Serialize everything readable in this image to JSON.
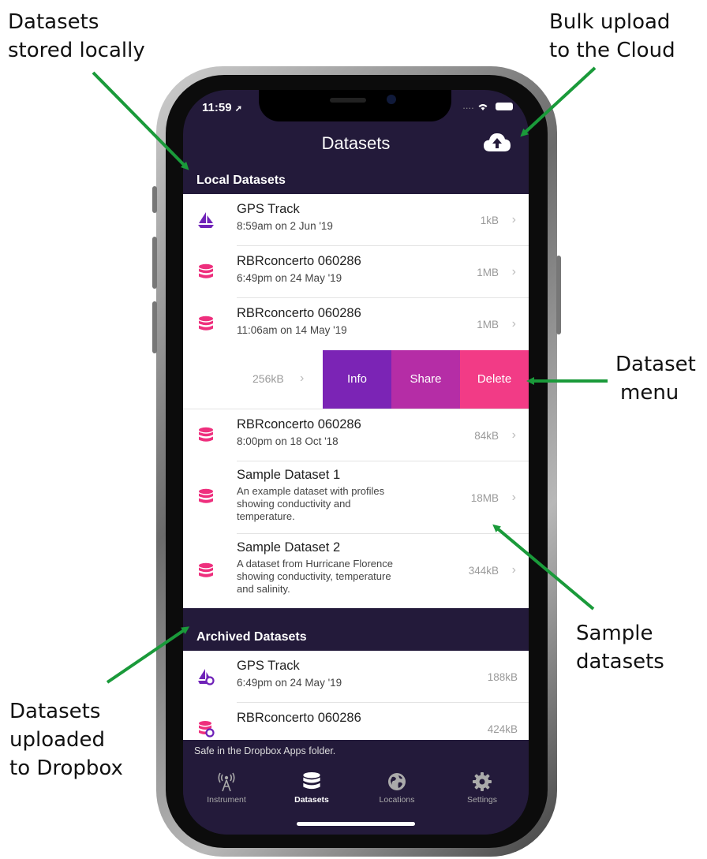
{
  "annotations": {
    "local_l1": "Datasets",
    "local_l2": "stored locally",
    "bulk_l1": "Bulk upload",
    "bulk_l2": "to the Cloud",
    "menu_l1": "Dataset",
    "menu_l2": "menu",
    "sample_l1": "Sample",
    "sample_l2": "datasets",
    "dropbox_l1": "Datasets",
    "dropbox_l2": "uploaded",
    "dropbox_l3": "to Dropbox",
    "arrow_color": "#1a9a3a"
  },
  "status": {
    "time": "11:59",
    "signal": "...."
  },
  "nav": {
    "title": "Datasets",
    "upload_icon": "cloud-upload-icon"
  },
  "local": {
    "header": "Local Datasets",
    "rows": [
      {
        "icon": "sailboat-icon",
        "title": "GPS Track",
        "sub": "8:59am on 2 Jun '19",
        "size": "1kB"
      },
      {
        "icon": "database-icon",
        "title": "RBRconcerto 060286",
        "sub": "6:49pm on 24 May '19",
        "size": "1MB"
      },
      {
        "icon": "database-icon",
        "title": "RBRconcerto 060286",
        "sub": "11:06am on 14 May '19",
        "size": "1MB"
      }
    ],
    "swipe": {
      "size": "256kB",
      "info": "Info",
      "share": "Share",
      "delete": "Delete"
    },
    "rows2": [
      {
        "icon": "database-icon",
        "title": "RBRconcerto 060286",
        "sub": "8:00pm on 18 Oct '18",
        "size": "84kB"
      },
      {
        "icon": "database-icon",
        "title": "Sample Dataset 1",
        "desc1": "An example dataset with profiles",
        "desc2": "showing conductivity and",
        "desc3": "temperature.",
        "size": "18MB"
      },
      {
        "icon": "database-icon",
        "title": "Sample Dataset 2",
        "desc1": "A dataset from Hurricane Florence",
        "desc2": "showing conductivity, temperature",
        "desc3": "and salinity.",
        "size": "344kB"
      }
    ]
  },
  "archived": {
    "header": "Archived Datasets",
    "rows": [
      {
        "icon": "sailboat-cloud-icon",
        "title": "GPS Track",
        "sub": "6:49pm on 24 May '19",
        "size": "188kB"
      },
      {
        "icon": "database-cloud-icon",
        "title": "RBRconcerto 060286",
        "sub": "",
        "size": "424kB"
      }
    ]
  },
  "tabbar": {
    "banner": "Safe in the Dropbox Apps folder.",
    "tabs": [
      {
        "label": "Instrument",
        "icon": "antenna-icon"
      },
      {
        "label": "Datasets",
        "icon": "database-icon"
      },
      {
        "label": "Locations",
        "icon": "globe-icon"
      },
      {
        "label": "Settings",
        "icon": "gear-icon"
      }
    ]
  },
  "colors": {
    "header_bg": "#231a3a",
    "info": "#7b24b5",
    "share": "#b52da6",
    "delete": "#f23b86",
    "database_icon": "#ee2f7d",
    "sailboat_icon": "#6f22b8"
  }
}
